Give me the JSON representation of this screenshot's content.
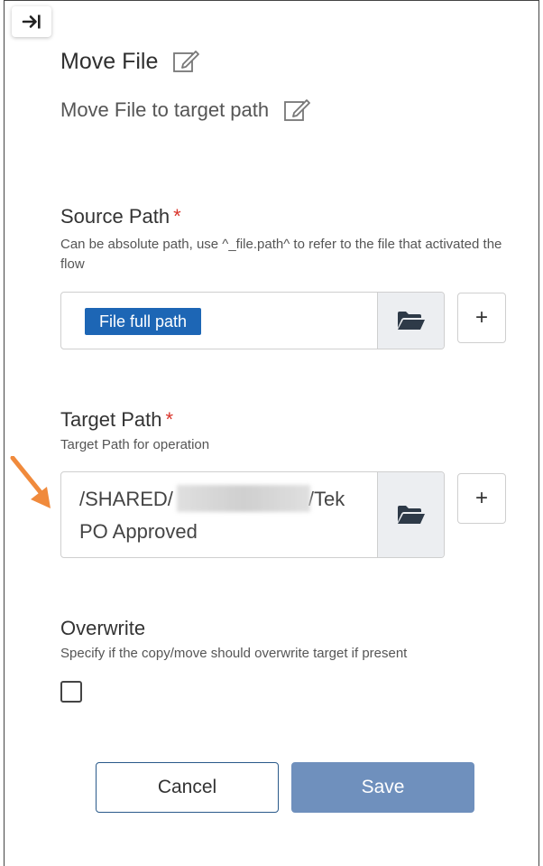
{
  "header": {
    "title": "Move File",
    "description": "Move File to target path"
  },
  "source_path": {
    "label": "Source Path",
    "required_mark": "*",
    "help": "Can be absolute path, use ^_file.path^ to refer to the file that activated the flow",
    "chip": "File full path",
    "add_label": "+"
  },
  "target_path": {
    "label": "Target Path",
    "required_mark": "*",
    "help": "Target Path for operation",
    "value_part1": "/SHARED/",
    "value_part2": "/Tek PO Approved",
    "add_label": "+"
  },
  "overwrite": {
    "label": "Overwrite",
    "help": "Specify if the copy/move should overwrite target if present",
    "checked": false
  },
  "actions": {
    "cancel": "Cancel",
    "save": "Save"
  },
  "colors": {
    "chip": "#1d66b5",
    "save": "#6f90bd",
    "required": "#d9342b",
    "annotation_arrow": "#f08a3c"
  },
  "icons": [
    "collapse-panel-icon",
    "edit-icon",
    "folder-open-icon",
    "annotation-arrow-icon"
  ]
}
